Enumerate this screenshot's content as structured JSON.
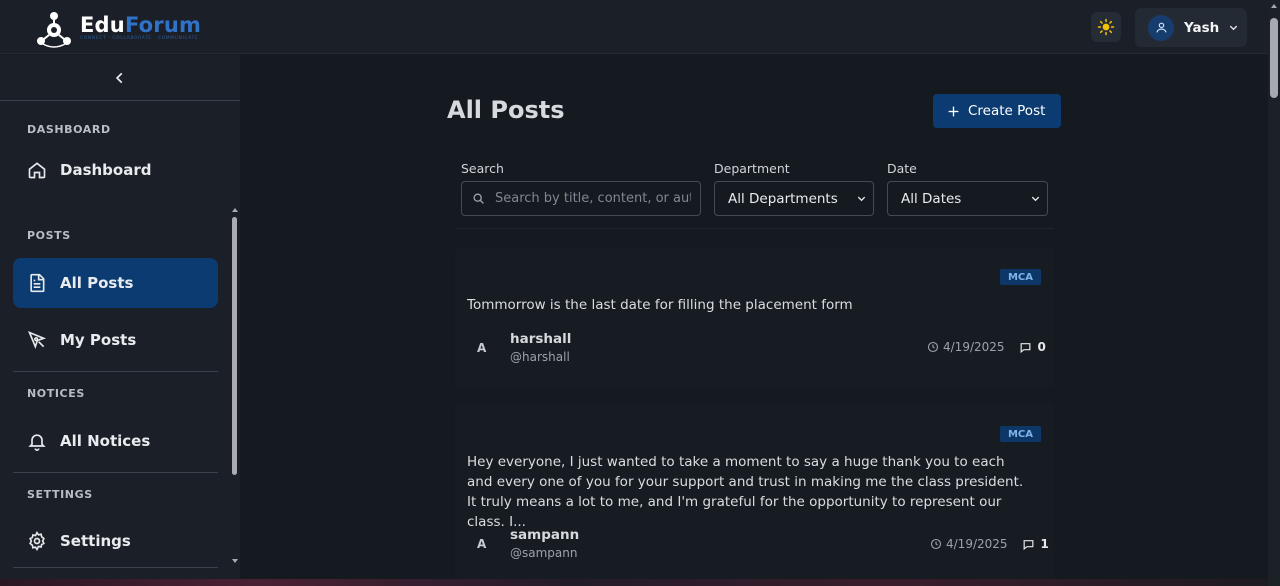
{
  "brand": {
    "name_part1": "Edu",
    "name_part2": "Forum",
    "tagline": "CONNECT · COLLABORATE · COMMUNICATE",
    "primary_color": "#2f73c9"
  },
  "header": {
    "theme_icon": "sun-icon",
    "user_name": "Yash",
    "user_icon": "user-icon",
    "menu_icon": "chevron-down-icon"
  },
  "sidebar": {
    "collapse_icon": "chevron-left-icon",
    "sections": [
      {
        "label": "DASHBOARD",
        "items": [
          {
            "label": "Dashboard",
            "icon": "home-icon",
            "active": false
          }
        ]
      },
      {
        "label": "POSTS",
        "items": [
          {
            "label": "All Posts",
            "icon": "document-icon",
            "active": true
          },
          {
            "label": "My Posts",
            "icon": "pen-icon",
            "active": false
          }
        ]
      },
      {
        "label": "NOTICES",
        "items": [
          {
            "label": "All Notices",
            "icon": "bell-icon",
            "active": false
          }
        ]
      },
      {
        "label": "SETTINGS",
        "items": [
          {
            "label": "Settings",
            "icon": "gear-icon",
            "active": false
          }
        ]
      }
    ]
  },
  "main": {
    "title": "All Posts",
    "create_button": "Create Post",
    "filters": {
      "search_label": "Search",
      "search_placeholder": "Search by title, content, or author",
      "search_value": "",
      "department_label": "Department",
      "department_value": "All Departments",
      "date_label": "Date",
      "date_value": "All Dates"
    },
    "posts": [
      {
        "tag": "MCA",
        "content": "Tommorrow is the last date for filling the placement form",
        "avatar_letter": "A",
        "author": "harshall",
        "handle": "@harshall",
        "date": "4/19/2025",
        "comments": "0"
      },
      {
        "tag": "MCA",
        "content": "Hey everyone, I just wanted to take a moment to say a huge thank you to each and every one of you for your support and trust in making me the class president. It truly means a lot to me, and I'm grateful for the opportunity to represent our class. I...",
        "avatar_letter": "A",
        "author": "sampann",
        "handle": "@sampann",
        "date": "4/19/2025",
        "comments": "1"
      }
    ]
  }
}
